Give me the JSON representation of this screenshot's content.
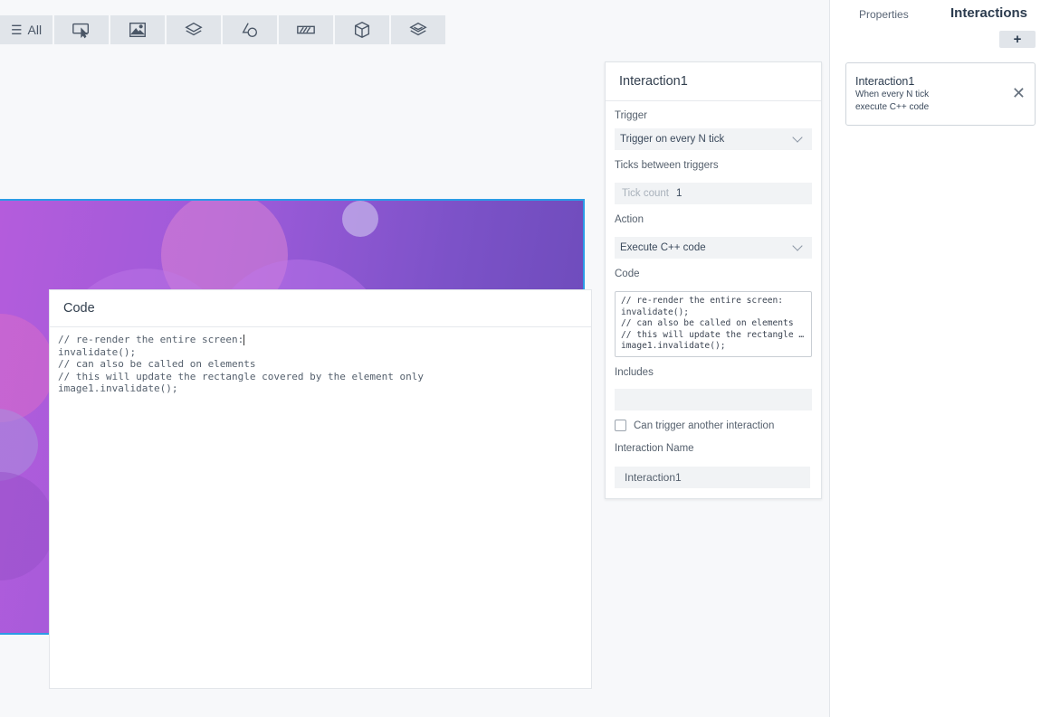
{
  "toolbar": {
    "all_label": "All",
    "tools": [
      "interaction-tool-icon",
      "image-icon",
      "layers-icon",
      "shapes-icon",
      "progress-icon",
      "box-icon",
      "stack-icon"
    ]
  },
  "code_panel": {
    "title": "Code",
    "lines": [
      "// re-render the entire screen:",
      "invalidate();",
      "// can also be called on elements",
      "// this will update the rectangle covered by the element only",
      "image1.invalidate();"
    ]
  },
  "interaction_panel": {
    "title": "Interaction1",
    "trigger_label": "Trigger",
    "trigger_value": "Trigger on every N tick",
    "ticks_label": "Ticks between triggers",
    "tick_placeholder": "Tick count",
    "tick_value": "1",
    "action_label": "Action",
    "action_value": "Execute C++ code",
    "code_label": "Code",
    "code_lines": [
      "// re-render the entire screen:",
      "invalidate();",
      "// can also be called on elements",
      "// this will update the rectangle covered by the element only",
      "image1.invalidate();"
    ],
    "includes_label": "Includes",
    "can_trigger_label": "Can trigger another interaction",
    "name_label": "Interaction Name",
    "name_value": "Interaction1"
  },
  "sidebar": {
    "tab_properties": "Properties",
    "tab_interactions": "Interactions",
    "add_label": "+",
    "card": {
      "name": "Interaction1",
      "description": "When every N tick\nexecute C++ code",
      "close": "✕"
    }
  }
}
